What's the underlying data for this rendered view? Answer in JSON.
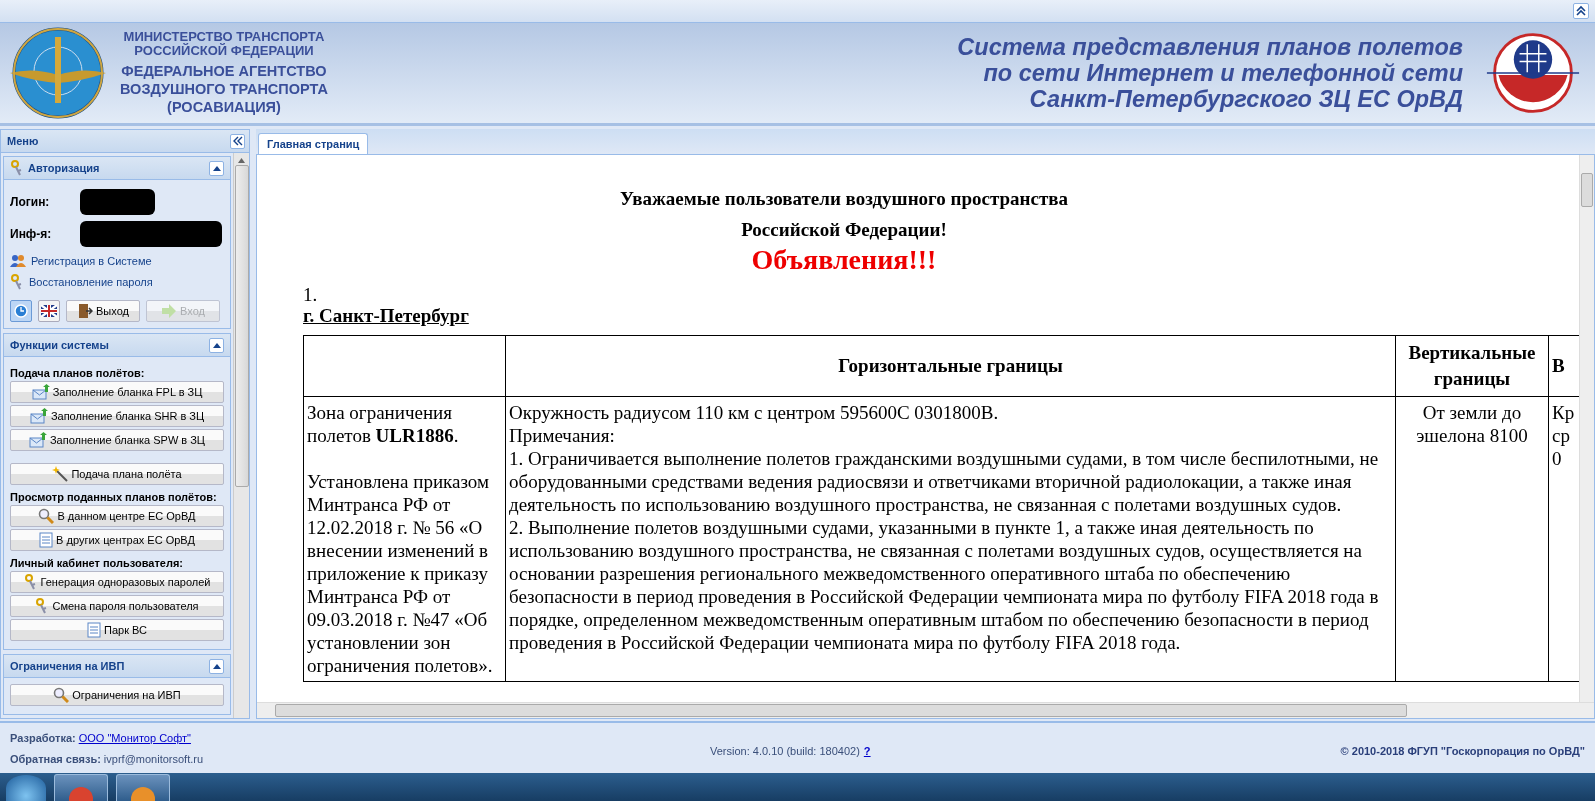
{
  "header": {
    "ministry_lines": [
      "МИНИСТЕРСТВО ТРАНСПОРТА",
      "РОССИЙСКОЙ ФЕДЕРАЦИИ"
    ],
    "agency_lines": [
      "ФЕДЕРАЛЬНОЕ АГЕНТСТВО",
      "ВОЗДУШНОГО ТРАНСПОРТА",
      "(РОСАВИАЦИЯ)"
    ],
    "system_title_lines": [
      "Система представления планов полетов",
      "по сети Интернет и телефонной сети",
      "Санкт-Петербургского ЗЦ ЕС ОрВД"
    ]
  },
  "sidebar": {
    "title": "Меню",
    "auth_panel": {
      "title": "Авторизация",
      "expanded": true,
      "fields": [
        {
          "label": "Логин:"
        },
        {
          "label": "Инф-я:"
        }
      ],
      "links": [
        "Регистрация в Системе",
        "Восстановление пароля"
      ],
      "icon_buttons": [
        {
          "selected": true
        },
        {
          "selected": false
        }
      ],
      "buttons": [
        {
          "label": "Выход",
          "disabled": false
        },
        {
          "label": "Вход",
          "disabled": true
        }
      ]
    },
    "panels": [
      {
        "title": "Функции системы",
        "expanded": true,
        "items": [
          {
            "kind": "heading",
            "label": "Подача планов полётов:"
          },
          {
            "kind": "button",
            "label": "Заполнение бланка FPL в ЗЦ"
          },
          {
            "kind": "button",
            "label": "Заполнение бланка SHR в ЗЦ"
          },
          {
            "kind": "button",
            "label": "Заполнение бланка SPW в ЗЦ"
          },
          {
            "kind": "spacer"
          },
          {
            "kind": "button",
            "label": "Подача плана полёта"
          },
          {
            "kind": "heading",
            "label": "Просмотр поданных планов полётов:"
          },
          {
            "kind": "button",
            "label": "В данном центре ЕС ОрВД"
          },
          {
            "kind": "button",
            "label": "В других центрах ЕС ОрВД"
          },
          {
            "kind": "heading",
            "label": "Личный кабинет пользователя:"
          },
          {
            "kind": "button",
            "label": "Генерация одноразовых паролей"
          },
          {
            "kind": "button",
            "label": "Смена пароля пользователя"
          },
          {
            "kind": "button",
            "label": "Парк ВС"
          }
        ]
      },
      {
        "title": "Ограничения на ИВП",
        "expanded": true,
        "items": [
          {
            "kind": "button",
            "label": "Ограничения на ИВП"
          }
        ]
      }
    ]
  },
  "tabs": [
    {
      "label": "Главная страниц",
      "selected": true
    }
  ],
  "content": {
    "greeting_lines": [
      "Уважаемые пользователи воздушного пространства",
      "Российской Федерации!"
    ],
    "announcement": "Объявления!!!",
    "item_number": "1.",
    "city": "г. Санкт-Петербург",
    "table": {
      "columns": [
        "",
        "Горизонтальные границы",
        "Вертикальные границы",
        "В"
      ],
      "rows": [
        {
          "cells": [
            [
              "Зона ограничения полетов **ULR1886**.",
              "Установлена приказом Минтранса РФ от 12.02.2018 г. № 56 «О внесении изменений в приложение к приказу Минтранса РФ от 09.03.2018 г. №47 «Об установлении зон ограничения полетов»."
            ],
            [
              "Окружность радиусом 110 км с центром 595600С 0301800В.",
              "Примечания:",
              "1. Ограничивается выполнение полетов гражданскими воздушными судами, в том числе беспилотными, не оборудованными средствами ведения радиосвязи и ответчиками вторичной радиолокации, а также иная деятельность по использованию воздушного пространства, не связанная с полетами воздушных судов.",
              "2. Выполнение полетов воздушными судами, указанными в пункте 1, а также иная деятельность по использованию воздушного пространства, не связанная с полетами воздушных судов, осуществляется на основании разрешения регионального межведомственного оперативного штаба по обеспечению безопасности в период проведения в Российской Федерации чемпионата мира по футболу FIFA 2018 года в порядке, определенном межведомственным оперативным штабом по обеспечению безопасности в период проведения в Российской Федерации чемпионата мира по футболу FIFA 2018 года."
            ],
            [
              "От земли до эшелона 8100"
            ],
            [
              "Кр",
              "ср",
              "0"
            ]
          ]
        }
      ]
    }
  },
  "footer": {
    "developer_label": "Разработка:",
    "developer_link": "ООО \"Монитор Софт\"",
    "feedback_label": "Обратная связь:",
    "feedback_email": "ivprf@monitorsoft.ru",
    "version": "Version: 4.0.10 (build: 180402)",
    "help_link": "?",
    "copyright": "© 2010-2018 ФГУП \"Госкорпорация по ОрВД\""
  }
}
